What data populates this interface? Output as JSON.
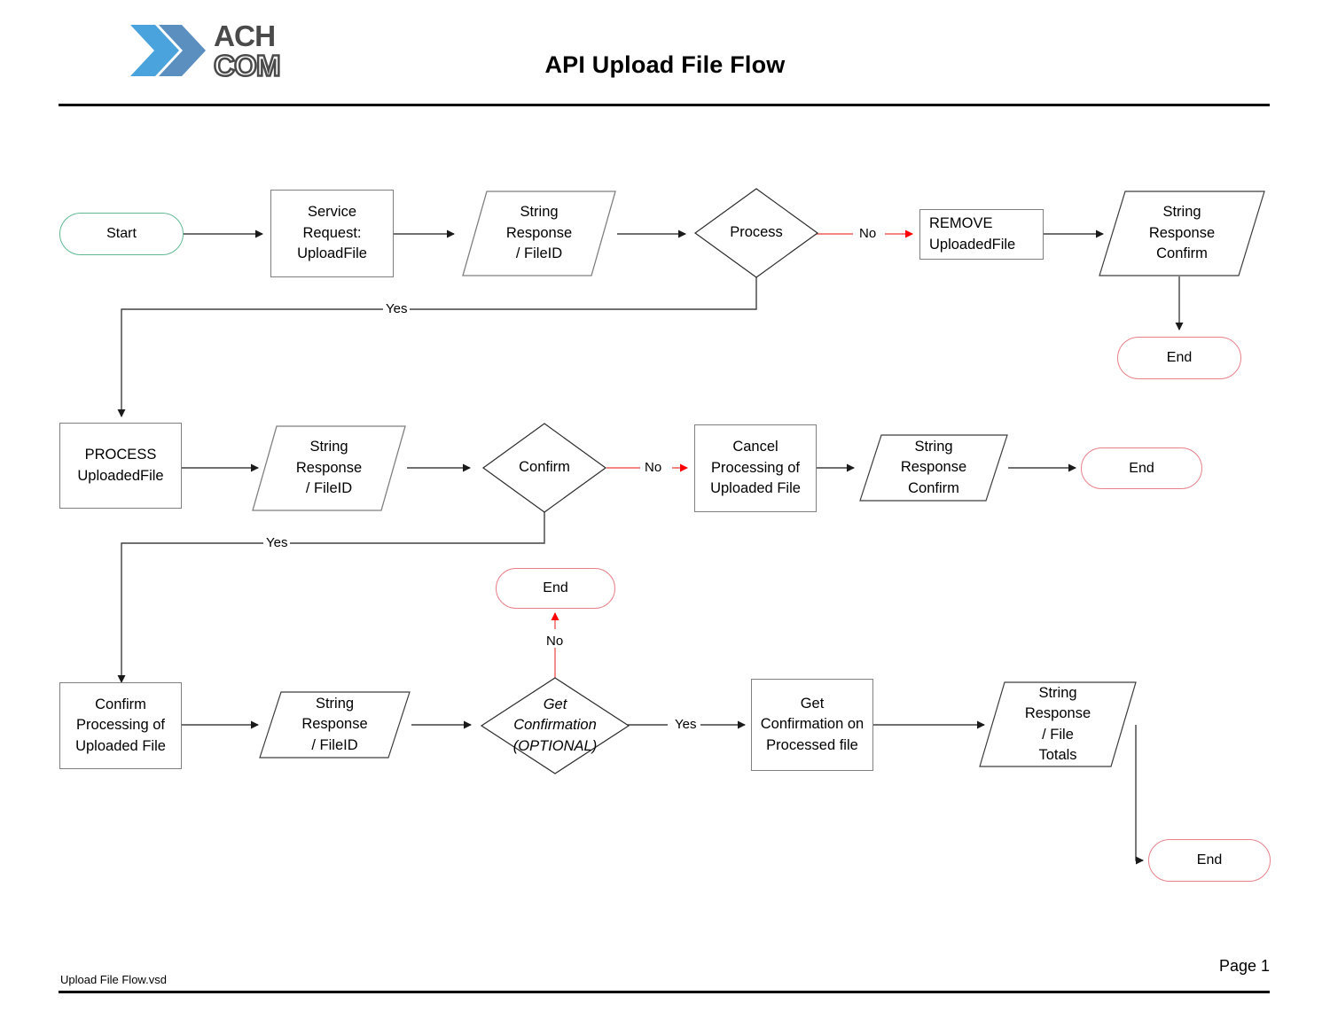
{
  "header": {
    "title": "API Upload File Flow",
    "logo": {
      "line1": "ACH",
      "line2": "COM",
      "chevron_light": "#4aa3dc",
      "chevron_dark": "#5a8fc0",
      "text_color": "#4a4a4a"
    }
  },
  "footer": {
    "file_name": "Upload File Flow.vsd",
    "page_label": "Page 1"
  },
  "colors": {
    "shape_stroke": "#7f7f7f",
    "connector": "#404040",
    "no_branch": "#ff0000",
    "no_branch_line": "#e8818a",
    "start_stroke": "#5fb894",
    "end_stroke": "#e8818a"
  },
  "nodes": {
    "start": {
      "label": "Start",
      "shape": "terminator"
    },
    "service_request": {
      "label": "Service Request:\nUploadFile",
      "shape": "process"
    },
    "resp_fileid_1": {
      "label": "String\nResponse\n/ FileID",
      "shape": "data"
    },
    "process_decision": {
      "label": "Process",
      "shape": "decision"
    },
    "remove_uploadedfile": {
      "label": "REMOVE\nUploadedFile",
      "shape": "process"
    },
    "resp_confirm_1": {
      "label": "String\nResponse\nConfirm",
      "shape": "data"
    },
    "end_1": {
      "label": "End",
      "shape": "terminator"
    },
    "process_uploadedfile": {
      "label": "PROCESS\nUploadedFile",
      "shape": "process"
    },
    "resp_fileid_2": {
      "label": "String\nResponse\n/ FileID",
      "shape": "data"
    },
    "confirm_decision": {
      "label": "Confirm",
      "shape": "decision"
    },
    "cancel_processing": {
      "label": "Cancel\nProcessing of\nUploaded File",
      "shape": "process"
    },
    "resp_confirm_2": {
      "label": "String\nResponse\nConfirm",
      "shape": "data"
    },
    "end_2": {
      "label": "End",
      "shape": "terminator"
    },
    "end_3": {
      "label": "End",
      "shape": "terminator"
    },
    "confirm_processing": {
      "label": "Confirm\nProcessing of\nUploaded File",
      "shape": "process"
    },
    "resp_fileid_3": {
      "label": "String\nResponse\n/ FileID",
      "shape": "data"
    },
    "get_confirmation_decision": {
      "label": "Get\nConfirmation\n(OPTIONAL)",
      "shape": "decision",
      "italic": true
    },
    "get_confirmation_on_processed": {
      "label": "Get\nConfirmation on\nProcessed file",
      "shape": "process"
    },
    "resp_file_totals": {
      "label": "String\nResponse\n/ File\nTotals",
      "shape": "data"
    },
    "end_4": {
      "label": "End",
      "shape": "terminator"
    }
  },
  "edge_labels": {
    "process_no": "No",
    "process_yes": "Yes",
    "confirm_no": "No",
    "confirm_yes": "Yes",
    "getconf_no": "No",
    "getconf_yes": "Yes"
  },
  "node_text_lines": {
    "service_request": [
      "Service Request:",
      "UploadFile"
    ],
    "resp_fileid_1": [
      "String",
      "Response",
      "/ FileID"
    ],
    "remove_uploadedfile": [
      "REMOVE",
      "UploadedFile"
    ],
    "resp_confirm_1": [
      "String",
      "Response",
      "Confirm"
    ],
    "process_uploadedfile": [
      "PROCESS",
      "UploadedFile"
    ],
    "resp_fileid_2": [
      "String",
      "Response",
      "/ FileID"
    ],
    "cancel_processing": [
      "Cancel",
      "Processing of",
      "Uploaded File"
    ],
    "resp_confirm_2": [
      "String",
      "Response",
      "Confirm"
    ],
    "confirm_processing": [
      "Confirm",
      "Processing of",
      "Uploaded File"
    ],
    "resp_fileid_3": [
      "String",
      "Response",
      "/ FileID"
    ],
    "get_confirmation_decision": [
      "Get",
      "Confirmation",
      "(OPTIONAL)"
    ],
    "get_confirmation_on_processed": [
      "Get",
      "Confirmation on",
      "Processed file"
    ],
    "resp_file_totals": [
      "String",
      "Response",
      "/ File",
      "Totals"
    ]
  }
}
